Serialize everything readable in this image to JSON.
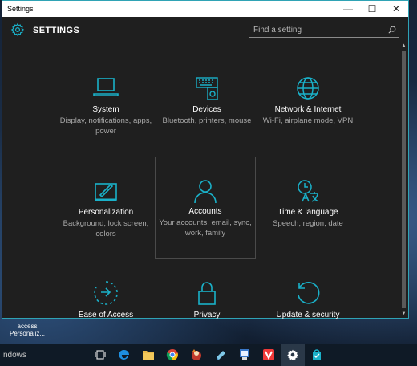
{
  "window": {
    "title": "Settings",
    "min_glyph": "—",
    "max_glyph": "☐",
    "close_glyph": "✕"
  },
  "header": {
    "title": "SETTINGS",
    "search_placeholder": "Find a setting"
  },
  "accent_color": "#1ab1c9",
  "tiles": [
    {
      "name": "System",
      "desc": "Display, notifications, apps, power",
      "icon": "laptop-icon"
    },
    {
      "name": "Devices",
      "desc": "Bluetooth, printers, mouse",
      "icon": "devices-icon"
    },
    {
      "name": "Network & Internet",
      "desc": "Wi-Fi, airplane mode, VPN",
      "icon": "globe-icon"
    },
    {
      "name": "Personalization",
      "desc": "Background, lock screen, colors",
      "icon": "paint-icon"
    },
    {
      "name": "Accounts",
      "desc": "Your accounts, email, sync, work, family",
      "icon": "person-icon"
    },
    {
      "name": "Time & language",
      "desc": "Speech, region, date",
      "icon": "time-language-icon"
    },
    {
      "name": "Ease of Access",
      "desc": "",
      "icon": "ease-of-access-icon"
    },
    {
      "name": "Privacy",
      "desc": "",
      "icon": "lock-icon"
    },
    {
      "name": "Update & security",
      "desc": "",
      "icon": "update-icon"
    }
  ],
  "desktop": {
    "icon_label": "access Personaliz..."
  },
  "taskbar": {
    "search_text": "ndows",
    "apps": [
      "task-view-icon",
      "edge-icon",
      "file-explorer-icon",
      "chrome-icon",
      "game-icon",
      "notepad-icon",
      "paint-app-icon",
      "vivaldi-icon",
      "settings-icon",
      "store-icon"
    ]
  }
}
